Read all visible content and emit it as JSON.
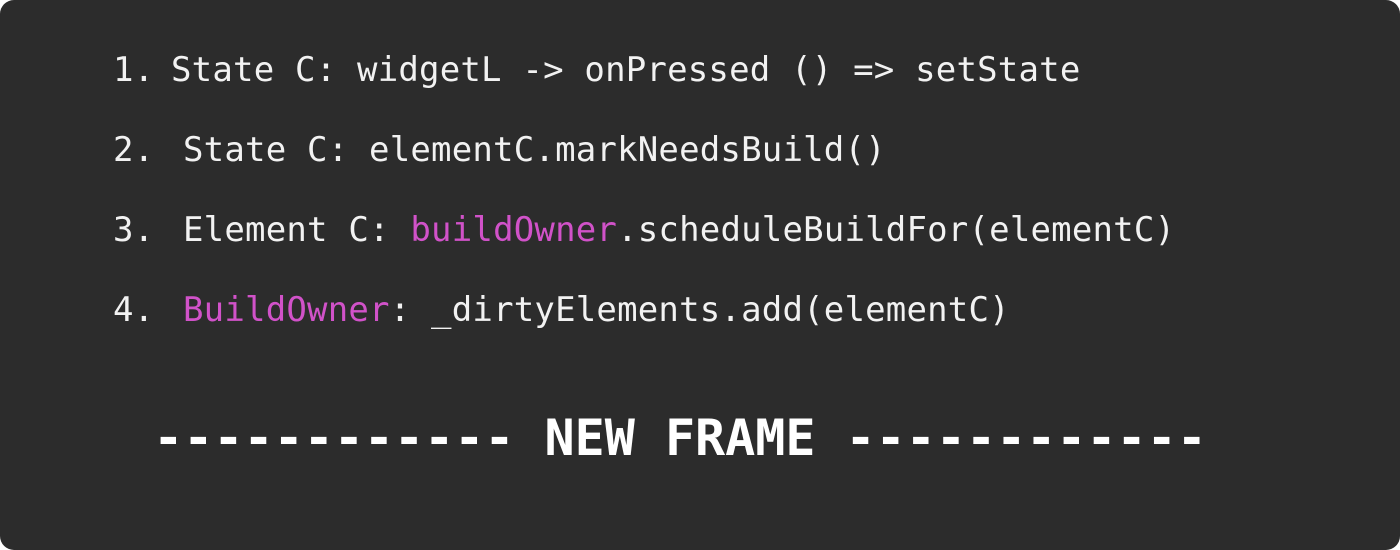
{
  "colors": {
    "background": "#2c2c2c",
    "text": "#f2f2f2",
    "highlight": "#d152c9"
  },
  "steps": [
    {
      "number": "1.",
      "text": "State C: widgetL -> onPressed () => setState"
    },
    {
      "number": "2.",
      "text": "State C: elementC.markNeedsBuild()"
    },
    {
      "number": "3.",
      "prefix": "Element C: ",
      "highlight": "buildOwner",
      "suffix": ".scheduleBuildFor(elementC)"
    },
    {
      "number": "4.",
      "highlight": "BuildOwner",
      "suffix": ": _dirtyElements.add(elementC)"
    }
  ],
  "divider": {
    "label": "------------ NEW FRAME ------------"
  }
}
